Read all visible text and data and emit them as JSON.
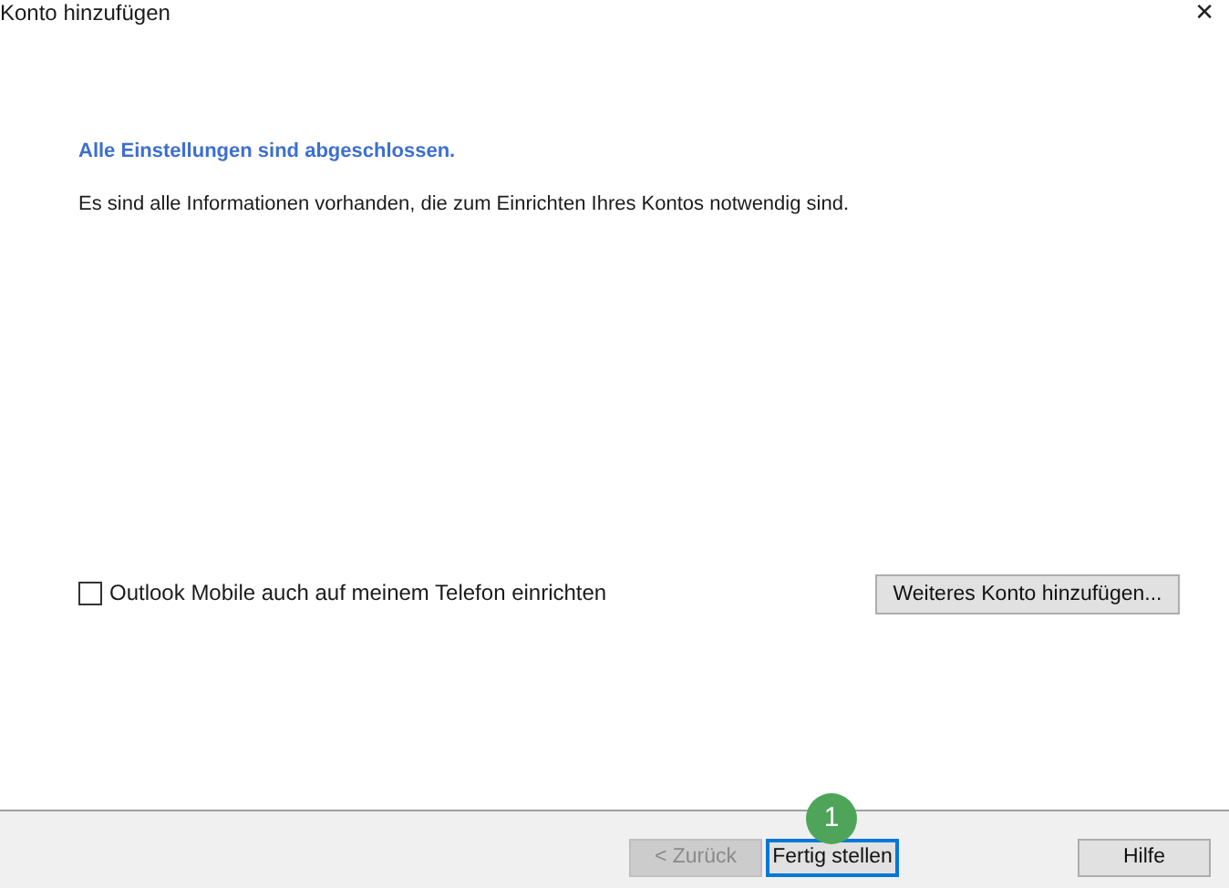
{
  "window": {
    "title": "Konto hinzufügen",
    "close": "✕"
  },
  "heading": "Alle Einstellungen sind abgeschlossen.",
  "message": "Es sind alle Informationen vorhanden, die zum Einrichten Ihres Kontos notwendig sind.",
  "checkbox": {
    "label": "Outlook Mobile auch auf meinem Telefon einrichten",
    "checked": false
  },
  "add_button": "Weiteres Konto hinzufügen...",
  "buttons": [
    {
      "label": "< Zurück",
      "disabled": true,
      "default": false
    },
    {
      "label": "Fertig stellen",
      "disabled": false,
      "default": true,
      "badge": "1"
    }
  ],
  "help_button": "Hilfe"
}
